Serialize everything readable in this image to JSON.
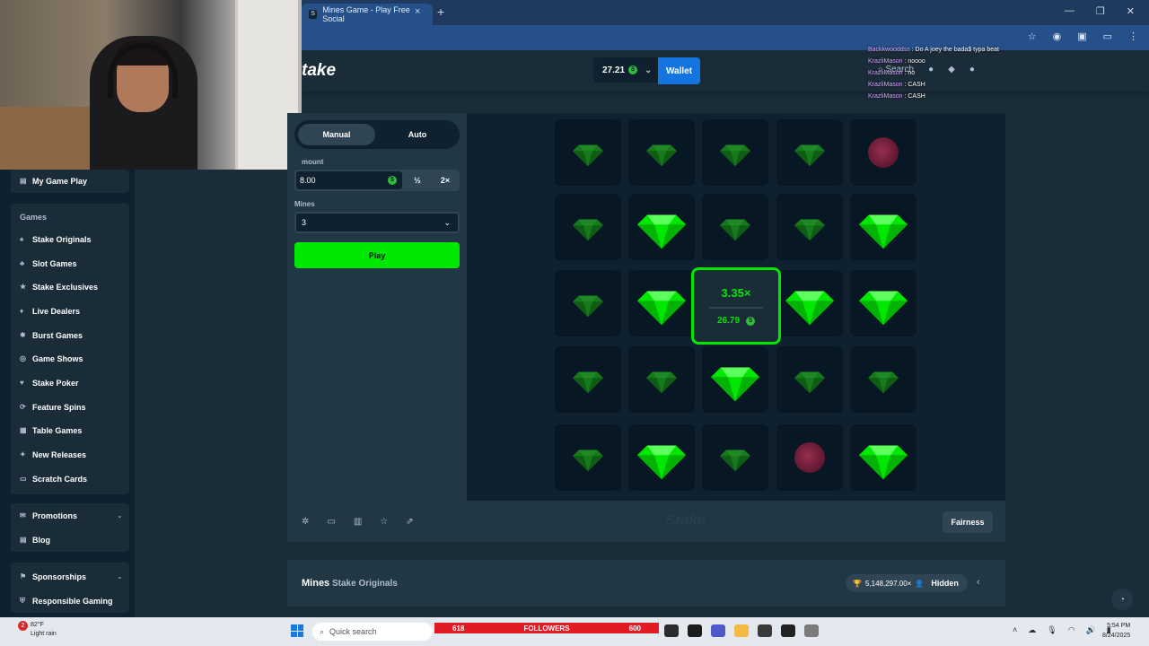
{
  "browser": {
    "tab_title": "Mines Game - Play Free Social",
    "tab_favicon": "S",
    "close_tab": "×",
    "new_tab": "+",
    "window_controls": [
      "—",
      "❐",
      "✕"
    ]
  },
  "header": {
    "logo": "take",
    "balance": "27.21",
    "currency_symbol": "$",
    "balance_dropdown": "⌄",
    "wallet_label": "Wallet",
    "search_label": "Search"
  },
  "chat": [
    {
      "user": "Backkwooddss",
      "message": "Do A joey the bada$ typa beat"
    },
    {
      "user": "KrazliMason",
      "message": "noooo"
    },
    {
      "user": "KrazliMason",
      "message": "no"
    },
    {
      "user": "KrazliMason",
      "message": "CASH"
    },
    {
      "user": "KrazliMason",
      "message": "CASH"
    }
  ],
  "sidebar": {
    "my_game_play": "My Game Play",
    "games_heading": "Games",
    "items": [
      {
        "label": "Stake Originals"
      },
      {
        "label": "Slot Games"
      },
      {
        "label": "Stake Exclusives"
      },
      {
        "label": "Live Dealers"
      },
      {
        "label": "Burst Games"
      },
      {
        "label": "Game Shows"
      },
      {
        "label": "Stake Poker"
      },
      {
        "label": "Feature Spins"
      },
      {
        "label": "Table Games"
      },
      {
        "label": "New Releases"
      },
      {
        "label": "Scratch Cards"
      }
    ],
    "promotions": "Promotions",
    "blog": "Blog",
    "sponsorships": "Sponsorships",
    "responsible_gaming": "Responsible Gaming"
  },
  "controls": {
    "tab_manual": "Manual",
    "tab_auto": "Auto",
    "bet_label": "mount",
    "bet_value": "8.00",
    "half_label": "½",
    "double_label": "2×",
    "mines_label": "Mines",
    "mines_value": "3",
    "play_label": "Play"
  },
  "board": {
    "grid": [
      [
        "gem-hidden",
        "gem-hidden",
        "gem-hidden",
        "gem-hidden",
        "mine"
      ],
      [
        "gem-hidden",
        "gem",
        "gem-hidden",
        "gem-hidden",
        "gem"
      ],
      [
        "gem-hidden",
        "gem",
        "win",
        "gem",
        "gem"
      ],
      [
        "gem-hidden",
        "gem-hidden",
        "gem",
        "gem-hidden",
        "gem-hidden"
      ],
      [
        "gem-hidden",
        "gem",
        "gem-hidden",
        "mine",
        "gem"
      ]
    ],
    "win_multiplier": "3.35×",
    "win_amount": "26.79"
  },
  "footer": {
    "watermark": "Stake",
    "fairness": "Fairness"
  },
  "game_info": {
    "name": "Mines",
    "category": "Stake Originals",
    "record": "5,148,297.00×",
    "hidden": "Hidden"
  },
  "taskbar": {
    "notification_count": "2",
    "temperature": "82°F",
    "weather": "Light rain",
    "search_placeholder": "Quick search",
    "followers_current": "618",
    "followers_label": "FOLLOWERS",
    "followers_goal": "600",
    "time": "5:54 PM",
    "date": "8/24/2025"
  },
  "colors": {
    "accent_green": "#00e701",
    "wallet_blue": "#1475e1",
    "bg_dark": "#0f212e",
    "bg_mid": "#1a2c38",
    "panel": "#213743"
  }
}
